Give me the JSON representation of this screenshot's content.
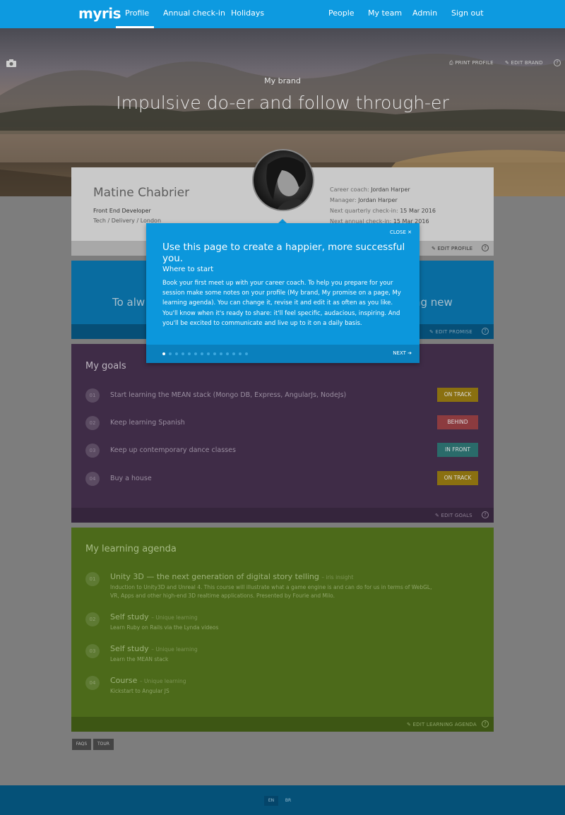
{
  "nav": {
    "logo": "myris",
    "left_links": [
      "Profile",
      "Annual check-in",
      "Holidays"
    ],
    "right_links": [
      "People",
      "My team",
      "Admin",
      "Sign out"
    ]
  },
  "hero": {
    "print_profile": "PRINT PROFILE",
    "edit_brand": "EDIT BRAND",
    "help": "?",
    "brand_label": "My brand",
    "brand_title": "Impulsive do-er and follow through-er"
  },
  "profile": {
    "name": "Matine Chabrier",
    "role": "Front End Developer",
    "dept": "Tech / Delivery / London",
    "career_coach_label": "Career coach:",
    "career_coach": "Jordan Harper",
    "manager_label": "Manager:",
    "manager": "Jordan Harper",
    "quarterly_label": "Next quarterly check-in:",
    "quarterly": "15 Mar 2016",
    "annual_label": "Next annual check-in:",
    "annual": "15 Mar 2016",
    "edit_label": "EDIT PROFILE"
  },
  "promise": {
    "text_left": "To alw",
    "text_right": "ng new",
    "edit_label": "EDIT PROMISE"
  },
  "goals": {
    "title": "My goals",
    "items": [
      {
        "num": "01",
        "text": "Start learning the MEAN stack (Mongo DB, Express, AngularJs, NodeJs)",
        "status": "ON TRACK"
      },
      {
        "num": "02",
        "text": "Keep learning Spanish",
        "status": "BEHIND"
      },
      {
        "num": "03",
        "text": "Keep up contemporary dance classes",
        "status": "IN FRONT"
      },
      {
        "num": "04",
        "text": "Buy a house",
        "status": "ON TRACK"
      }
    ],
    "edit_label": "EDIT GOALS",
    "colors": {
      "on_track": "#8a7010",
      "behind": "#8c3b3f",
      "in_front": "#2a6b6a"
    }
  },
  "learning": {
    "title": "My learning agenda",
    "items": [
      {
        "num": "01",
        "title": "Unity 3D — the next generation of digital story telling",
        "tag": "– iris insight",
        "desc": "Induction to Unity3D and Unreal 4. This course will illustrate what a game engine is and can do for us in terms of WebGL, VR, Apps and other high-end 3D realtime applications. Presented by Fourie and Milo."
      },
      {
        "num": "02",
        "title": "Self study",
        "tag": "– Unique learning",
        "desc": "Learn Ruby on Rails via the Lynda videos"
      },
      {
        "num": "03",
        "title": "Self study",
        "tag": "– Unique learning",
        "desc": "Learn the MEAN stack"
      },
      {
        "num": "04",
        "title": "Course",
        "tag": "– Unique learning",
        "desc": "Kickstart to Angular JS"
      }
    ],
    "edit_label": "EDIT LEARNING AGENDA"
  },
  "buttons": {
    "faqs": "FAQS",
    "tour": "TOUR"
  },
  "footer": {
    "lang_en": "EN",
    "lang_br": "BR"
  },
  "modal": {
    "close": "CLOSE ✕",
    "heading": "Use this page to create a happier, more successful you.",
    "sub": "Where to start",
    "body": "Book your first meet up with your career coach. To help you prepare for your session make some notes on your profile (My brand, My promise on a page, My learning agenda). You can change it, revise it and edit it as often as you like. You'll know when it's ready to share: it'll feel specific, audacious, inspiring. And you'll be excited to communicate and live up to it on a daily basis.",
    "next": "NEXT ➔",
    "page_count": 14,
    "current_page": 1
  }
}
